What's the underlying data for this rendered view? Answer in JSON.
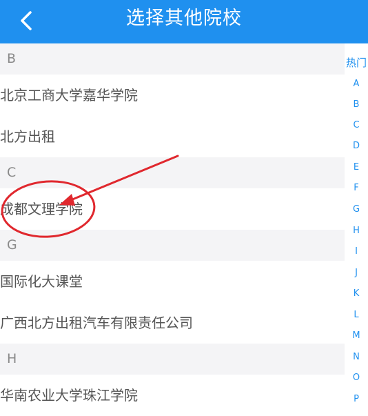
{
  "header": {
    "title": "选择其他院校",
    "back_icon": "chevron-left-icon",
    "color": "#1f90ef"
  },
  "sections": [
    {
      "letter": "B",
      "items": [
        "北京工商大学嘉华学院",
        "北方出租"
      ]
    },
    {
      "letter": "C",
      "items": [
        "成都文理学院"
      ]
    },
    {
      "letter": "G",
      "items": [
        "国际化大课堂",
        "广西北方出租汽车有限责任公司"
      ]
    },
    {
      "letter": "H",
      "items": [
        "华南农业大学珠江学院"
      ]
    }
  ],
  "index": [
    "热门",
    "A",
    "B",
    "C",
    "D",
    "E",
    "F",
    "G",
    "H",
    "I",
    "J",
    "K",
    "L",
    "M",
    "N",
    "O",
    "P"
  ],
  "annotation": {
    "color": "#e0282e",
    "shape": "red-circle-with-arrow"
  }
}
